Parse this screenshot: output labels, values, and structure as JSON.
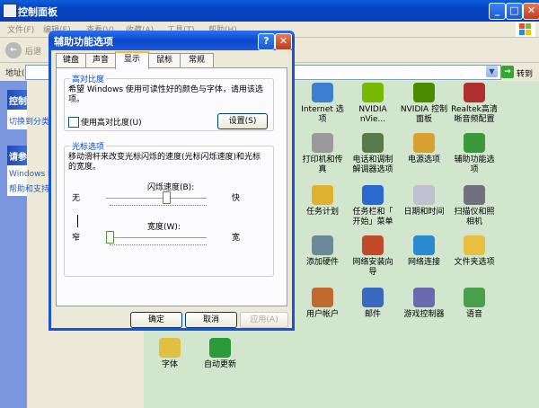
{
  "window": {
    "title": "控制面板",
    "min": "_",
    "max": "□",
    "close": "✕"
  },
  "menu": [
    "文件(F)",
    "编辑(E)",
    "查看(V)",
    "收藏(A)",
    "工具(T)",
    "帮助(H)"
  ],
  "toolbar": {
    "back_label": "后退"
  },
  "address": {
    "label": "地址(D)",
    "go_label": "转到"
  },
  "taskpane": {
    "panel1_title": "控制面板",
    "panel1_link": "切换到分类视图",
    "panel2_title": "请参阅",
    "panel2_links": [
      "Windows Update",
      "帮助和支持"
    ]
  },
  "items": [
    {
      "label": "Internet 选\n项",
      "icon": "internet-options-icon",
      "color": "#3a7fd0"
    },
    {
      "label": "NVIDIA\nnVie...",
      "icon": "nvidia-nview-icon",
      "color": "#76b900"
    },
    {
      "label": "NVIDIA 控制\n面板",
      "icon": "nvidia-control-panel-icon",
      "color": "#4a8a00"
    },
    {
      "label": "Realtek高清\n晰音频配置",
      "icon": "realtek-audio-icon",
      "color": "#b03030"
    },
    {
      "label": "打印机和传\n真",
      "icon": "printer-icon",
      "color": "#9a9a9a"
    },
    {
      "label": "电话和调制\n解调器选项",
      "icon": "phone-modem-icon",
      "color": "#5a7a4a"
    },
    {
      "label": "电源选项",
      "icon": "power-options-icon",
      "color": "#d8a030"
    },
    {
      "label": "辅助功能选\n项",
      "icon": "accessibility-icon",
      "color": "#3a9a3a"
    },
    {
      "label": "任务计划",
      "icon": "scheduled-tasks-icon",
      "color": "#e0b030"
    },
    {
      "label": "任务栏和「\n开始」菜单",
      "icon": "taskbar-start-icon",
      "color": "#2a6ad0"
    },
    {
      "label": "日期和时间",
      "icon": "date-time-icon",
      "color": "#c0c0d0"
    },
    {
      "label": "扫描仪和照\n相机",
      "icon": "scanner-camera-icon",
      "color": "#707080"
    },
    {
      "label": "添加硬件",
      "icon": "add-hardware-icon",
      "color": "#6a8a9a"
    },
    {
      "label": "网络安装向\n导",
      "icon": "network-setup-wizard-icon",
      "color": "#c04a2a"
    },
    {
      "label": "网络连接",
      "icon": "network-connections-icon",
      "color": "#2a8ad0"
    },
    {
      "label": "文件夹选项",
      "icon": "folder-options-icon",
      "color": "#e8c040"
    },
    {
      "label": "用户帐户",
      "icon": "user-accounts-icon",
      "color": "#c06a30"
    },
    {
      "label": "邮件",
      "icon": "mail-icon",
      "color": "#3a6ac0"
    },
    {
      "label": "游戏控制器",
      "icon": "game-controllers-icon",
      "color": "#6a6ab0"
    },
    {
      "label": "语音",
      "icon": "speech-icon",
      "color": "#4aa04a"
    },
    {
      "label": "字体",
      "icon": "fonts-icon",
      "color": "#e0c040"
    },
    {
      "label": "自动更新",
      "icon": "automatic-updates-icon",
      "color": "#2a9a3a"
    }
  ],
  "dialog": {
    "title": "辅助功能选项",
    "help": "?",
    "close": "✕",
    "tabs": [
      "键盘",
      "声音",
      "显示",
      "鼠标",
      "常规"
    ],
    "active_tab": "显示",
    "contrast": {
      "title": "高对比度",
      "desc_line1": "希望 Windows 使用可读性好的颜色与字体，请用该选",
      "desc_line2": "项。",
      "checkbox_label": "使用高对比度(U)",
      "checked": false,
      "settings_button": "设置(S)"
    },
    "cursor": {
      "title": "光标选项",
      "desc_line1": "移动滑杆来改变光标闪烁的速度(光标闪烁速度)和光标",
      "desc_line2": "的宽度。",
      "blink_label": "闪烁速度(B):",
      "blink_none": "无",
      "blink_fast": "快",
      "blink_value": 0.6,
      "width_label": "宽度(W):",
      "width_narrow": "窄",
      "width_wide": "宽",
      "width_value": 0.0
    },
    "ok": "确定",
    "cancel": "取消",
    "apply": "应用(A)"
  }
}
